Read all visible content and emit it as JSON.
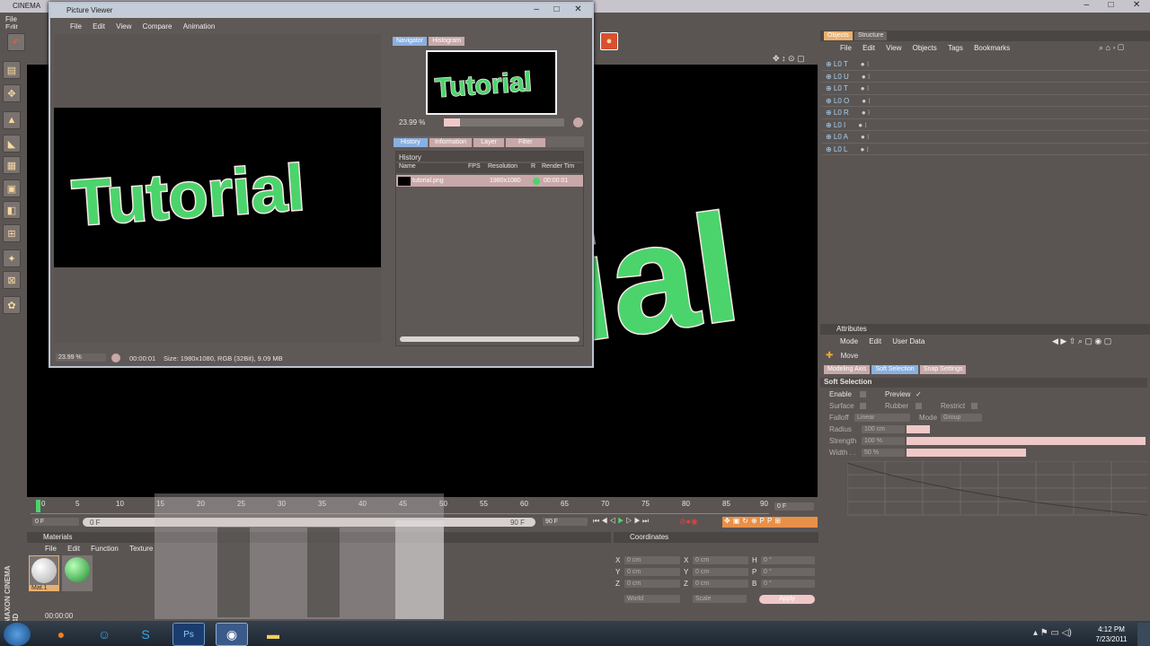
{
  "app": {
    "title_fragment": "CINEMA",
    "menu": [
      "File",
      "Edit"
    ],
    "window_controls": [
      "–",
      "□",
      "✕"
    ]
  },
  "picture_viewer": {
    "title": "Picture Viewer",
    "menu": [
      "File",
      "Edit",
      "View",
      "Compare",
      "Animation"
    ],
    "render_text": "Tutorial",
    "navigator_tabs": [
      "Navigator",
      "Histogram"
    ],
    "zoom": "23.99 %",
    "panel_tabs": [
      "History",
      "Information",
      "Layer",
      "Filter"
    ],
    "history_label": "History",
    "columns": [
      "Name",
      "FPS",
      "Resolution",
      "R",
      "Render Tim"
    ],
    "rows": [
      {
        "name": "tutorial.png",
        "fps": "",
        "resolution": "1980x1080",
        "time": "00:00:01"
      }
    ],
    "status_zoom": "23.99 %",
    "status_time": "00:00:01",
    "status_info": "Size: 1980x1080, RGB (32Bit), 9.09 MB"
  },
  "viewport": {
    "bg_text": "ial"
  },
  "objects": {
    "tabs": [
      "Objects",
      "Structure"
    ],
    "menu": [
      "File",
      "Edit",
      "View",
      "Objects",
      "Tags",
      "Bookmarks"
    ],
    "items": [
      "T",
      "U",
      "T",
      "O",
      "R",
      "I",
      "A",
      "L"
    ]
  },
  "attributes": {
    "header": "Attributes",
    "menu": [
      "Mode",
      "Edit",
      "User Data"
    ],
    "tool": "Move",
    "tabs": [
      "Modeling Axis",
      "Soft Selection",
      "Snap Settings"
    ],
    "section": "Soft Selection",
    "enable_label": "Enable",
    "preview_label": "Preview",
    "preview_check": "✓",
    "surface_label": "Surface",
    "rubber_label": "Rubber",
    "restrict_label": "Restrict",
    "falloff_label": "Falloff",
    "falloff_value": "Linear",
    "mode_label": "Mode",
    "mode_value": "Group",
    "radius_label": "Radius",
    "radius_value": "100 cm",
    "strength_label": "Strength",
    "strength_value": "100 %",
    "width_label": "Width . .",
    "width_value": "50 %"
  },
  "timeline": {
    "ticks": [
      "0",
      "5",
      "10",
      "15",
      "20",
      "25",
      "30",
      "35",
      "40",
      "45",
      "50",
      "55",
      "60",
      "65",
      "70",
      "75",
      "80",
      "85",
      "90"
    ],
    "current_frame": "0 F",
    "start": "0 F",
    "range_start": "0 F",
    "range_end": "90 F",
    "end": "90 F"
  },
  "materials": {
    "header": "Materials",
    "menu": [
      "File",
      "Edit",
      "Function",
      "Texture"
    ],
    "mat1_label": "Mat.1",
    "time": "00:00:00"
  },
  "coordinates": {
    "header": "Coordinates",
    "rows": [
      {
        "a": "X",
        "av": "0 cm",
        "b": "X",
        "bv": "0 cm",
        "c": "H",
        "cv": "0 °"
      },
      {
        "a": "Y",
        "av": "0 cm",
        "b": "Y",
        "bv": "0 cm",
        "c": "P",
        "cv": "0 °"
      },
      {
        "a": "Z",
        "av": "0 cm",
        "b": "Z",
        "bv": "0 cm",
        "c": "B",
        "cv": "0 °"
      }
    ],
    "world": "World",
    "scale": "Scale",
    "apply": "Apply"
  },
  "side_logo": "MAXON CINEMA 4D",
  "taskbar": {
    "clock_time": "4:12 PM",
    "clock_date": "7/23/2011",
    "ps_label": "Ps"
  },
  "colors": {
    "accent_green": "#4cd46c",
    "tab_blue": "#8ab0e0",
    "panel": "#5a5553"
  }
}
